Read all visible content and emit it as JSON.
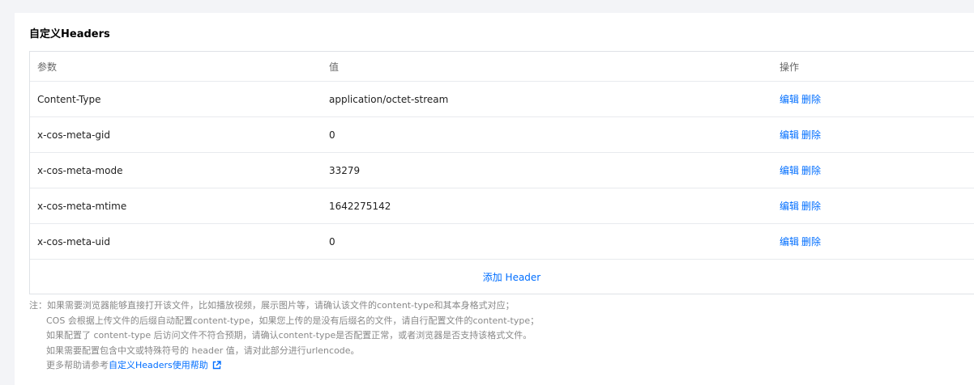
{
  "section": {
    "title": "自定义Headers"
  },
  "table": {
    "columns": [
      "参数",
      "值",
      "操作"
    ],
    "rows": [
      {
        "param": "Content-Type",
        "value": "application/octet-stream",
        "edit": "编辑",
        "delete": "删除"
      },
      {
        "param": "x-cos-meta-gid",
        "value": "0",
        "edit": "编辑",
        "delete": "删除"
      },
      {
        "param": "x-cos-meta-mode",
        "value": "33279",
        "edit": "编辑",
        "delete": "删除"
      },
      {
        "param": "x-cos-meta-mtime",
        "value": "1642275142",
        "edit": "编辑",
        "delete": "删除"
      },
      {
        "param": "x-cos-meta-uid",
        "value": "0",
        "edit": "编辑",
        "delete": "删除"
      }
    ],
    "add_label": "添加 Header"
  },
  "notes": {
    "lines": [
      "注：如果需要浏览器能够直接打开该文件，比如播放视频，展示图片等，请确认该文件的content-type和其本身格式对应；",
      "COS 会根据上传文件的后缀自动配置content-type，如果您上传的是没有后缀名的文件，请自行配置文件的content-type；",
      "如果配置了 content-type 后访问文件不符合预期，请确认content-type是否配置正常，或者浏览器是否支持该格式文件。",
      "如果需要配置包含中文或特殊符号的 header 值，请对此部分进行urlencode。"
    ],
    "help_prefix": "更多帮助请参考",
    "help_link": "自定义Headers使用帮助"
  },
  "icons": {
    "external_link": "external-link-icon"
  },
  "colors": {
    "link": "#006eff",
    "note": "#888888"
  }
}
